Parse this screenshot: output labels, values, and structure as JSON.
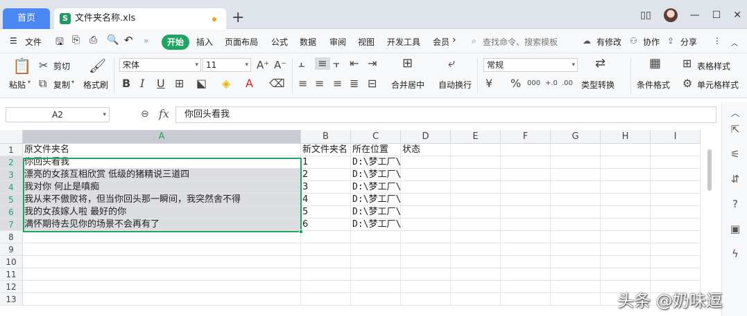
{
  "titlebar": {
    "home_tab": "首页",
    "doc_tab": "文件夹名称.xls",
    "new_tab": "+"
  },
  "menubar": {
    "file": "文件",
    "more": "»",
    "tabs": [
      "开始",
      "插入",
      "页面布局",
      "公式",
      "数据",
      "审阅",
      "视图",
      "开发工具",
      "会员"
    ],
    "search_placeholder": "查找命令、搜索模板",
    "has_changes": "有修改",
    "collaborate": "协作",
    "share": "分享"
  },
  "ribbon": {
    "paste": "粘贴",
    "cut": "剪切",
    "copy": "复制",
    "format_painter": "格式刷",
    "font_name": "宋体",
    "font_size": "11",
    "merge_center": "合并居中",
    "auto_wrap": "自动换行",
    "number_format": "常规",
    "type_convert": "类型转换",
    "conditional_format": "条件格式",
    "table_style": "表格样式",
    "cell_style": "单元格样式"
  },
  "formula_bar": {
    "name_box": "A2",
    "fx": "fx",
    "content": "你回头看我"
  },
  "sheet": {
    "columns": [
      "A",
      "B",
      "C",
      "D",
      "E",
      "F",
      "G",
      "H",
      "I"
    ],
    "rows": [
      "1",
      "2",
      "3",
      "4",
      "5",
      "6",
      "7",
      "8",
      "9",
      "10",
      "11",
      "12",
      "13"
    ],
    "cells": {
      "A1": "原文件夹名",
      "B1": "新文件夹名",
      "C1": "所在位置",
      "D1": "状态",
      "A2": "你回头看我",
      "B2": "1",
      "C2": "D:\\梦工厂\\",
      "A3": "漂亮的女孩互相欣赏 低级的猪精说三道四",
      "B3": "2",
      "C3": "D:\\梦工厂\\",
      "A4": "我对你 何止是嗔痴",
      "B4": "3",
      "C4": "D:\\梦工厂\\",
      "A5": "我从来不傲败将，但当你回头那一瞬间，我突然舍不得",
      "B5": "4",
      "C5": "D:\\梦工厂\\",
      "A6": "我的女孩嫁人啦 最好的你",
      "B6": "5",
      "C6": "D:\\梦工厂\\",
      "A7": "满怀期待去见你的场景不会再有了",
      "B7": "6",
      "C7": "D:\\梦工厂\\"
    }
  },
  "watermark": "头条 @奶味逗"
}
